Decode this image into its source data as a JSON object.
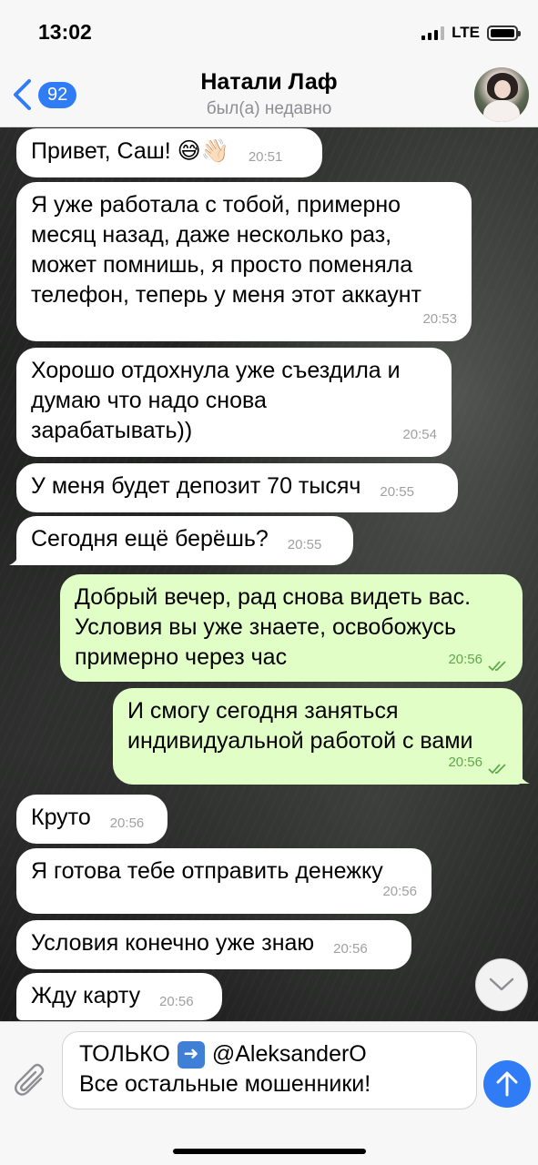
{
  "status_bar": {
    "time": "13:02",
    "network": "LTE"
  },
  "header": {
    "back_badge": "92",
    "title": "Натали Лаф",
    "subtitle": "был(а) недавно"
  },
  "messages": [
    {
      "dir": "in",
      "text": "Привет, Саш! 😅👋🏻",
      "time": "20:51"
    },
    {
      "dir": "in",
      "lines": [
        "Я уже работала с тобой, примерно",
        "месяц назад, даже несколько раз,",
        "может помнишь, я просто поменяла",
        "телефон, теперь у меня этот аккаунт"
      ],
      "time": "20:53"
    },
    {
      "dir": "in",
      "lines": [
        "Хорошо отдохнула уже съездила и",
        "думаю что надо снова",
        "зарабатывать))"
      ],
      "time": "20:54"
    },
    {
      "dir": "in",
      "text": "У меня будет депозит 70 тысяч",
      "time": "20:55"
    },
    {
      "dir": "in",
      "text": "Сегодня ещё берёшь?",
      "time": "20:55"
    },
    {
      "dir": "out",
      "lines": [
        "Добрый вечер, рад снова видеть вас.",
        "Условия вы уже знаете, освобожусь",
        "примерно через час"
      ],
      "time": "20:56",
      "status": "read"
    },
    {
      "dir": "out",
      "lines": [
        "И смогу сегодня заняться",
        "индивидуальной работой с вами"
      ],
      "time": "20:56",
      "status": "read"
    },
    {
      "dir": "in",
      "text": "Круто",
      "time": "20:56"
    },
    {
      "dir": "in",
      "text": "Я готова тебе отправить денежку",
      "time": "20:56"
    },
    {
      "dir": "in",
      "text": "Условия конечно уже знаю",
      "time": "20:56"
    },
    {
      "dir": "in",
      "text": "Жду карту",
      "time": "20:56"
    }
  ],
  "composer": {
    "line1_prefix": "ТОЛЬКО",
    "line1_icon": "right-arrow-emoji",
    "line1_suffix": "@AleksanderO",
    "line2": "Все остальные мошенники!"
  },
  "colors": {
    "incoming_bubble": "#ffffff",
    "outgoing_bubble": "#e1fec6",
    "accent": "#2f7cf6",
    "outgoing_time": "#5fa94b"
  }
}
